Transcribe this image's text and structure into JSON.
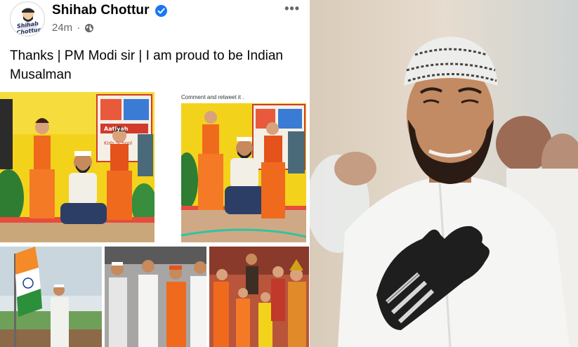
{
  "post": {
    "author": "Shihab Chottur",
    "time": "24m",
    "caption": "Thanks | PM Modi sir | I am proud to be Indian Musalman",
    "avatar_logo_text": "Shihab Chottur",
    "comment_note": "Comment and retweet it .",
    "icons": {
      "verified": "verified-badge-icon",
      "audience": "globe-icon",
      "menu": "more-options-icon"
    },
    "school_sign": [
      "Aatiyah",
      "Kids School"
    ]
  },
  "colors": {
    "verified_blue": "#1877f2",
    "meta_gray": "#65676b",
    "saffron": "#f06a1e",
    "school_yellow": "#f3d21b"
  }
}
